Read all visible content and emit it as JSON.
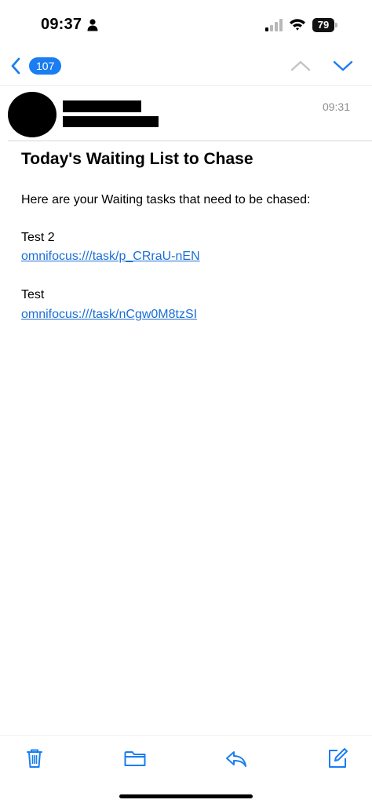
{
  "status_bar": {
    "time": "09:37",
    "battery": "79"
  },
  "nav": {
    "unread_count": "107"
  },
  "message": {
    "received_time": "09:31",
    "subject": "Today's Waiting List to Chase",
    "intro": "Here are your Waiting tasks that need to be chased:",
    "tasks": [
      {
        "title": "Test 2",
        "link": "omnifocus:///task/p_CRraU-nEN"
      },
      {
        "title": "Test",
        "link": "omnifocus:///task/nCgw0M8tzSI"
      }
    ]
  },
  "colors": {
    "accent": "#1a7df2",
    "link": "#1a6fd8",
    "muted": "#8e8e93"
  },
  "toolbar": {
    "icons": [
      "trash-icon",
      "folder-icon",
      "reply-icon",
      "compose-icon"
    ]
  }
}
